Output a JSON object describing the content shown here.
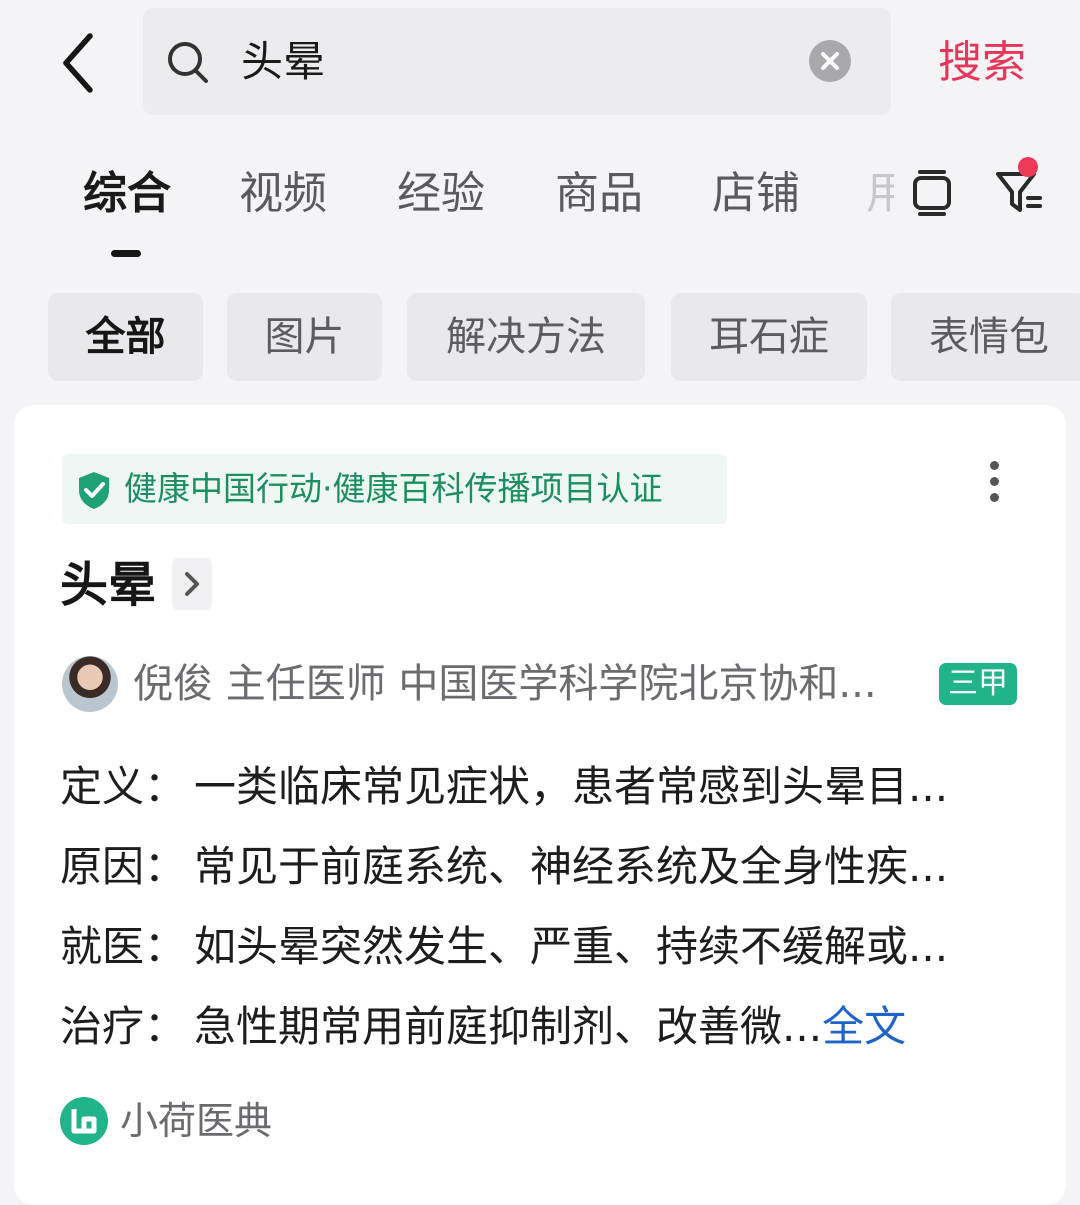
{
  "search": {
    "query": "头晕",
    "button_label": "搜索"
  },
  "tabs": [
    {
      "label": "综合",
      "active": true
    },
    {
      "label": "视频"
    },
    {
      "label": "经验"
    },
    {
      "label": "商品"
    },
    {
      "label": "店铺"
    }
  ],
  "tab_partial": "用",
  "chips": [
    {
      "label": "全部",
      "active": true
    },
    {
      "label": "图片"
    },
    {
      "label": "解决方法"
    },
    {
      "label": "耳石症"
    },
    {
      "label": "表情包"
    }
  ],
  "card": {
    "certification": "健康中国行动·健康百科传播项目认证",
    "title": "头晕",
    "doctor": "倪俊 主任医师 中国医学科学院北京协和...",
    "hospital_badge": "三甲",
    "rows": [
      {
        "label": "定义：",
        "text": "一类临床常见症状，患者常感到头晕目..."
      },
      {
        "label": "原因：",
        "text": "常见于前庭系统、神经系统及全身性疾..."
      },
      {
        "label": "就医：",
        "text": "如头晕突然发生、严重、持续不缓解或..."
      },
      {
        "label": "治疗：",
        "text": "急性期常用前庭抑制剂、改善微..."
      }
    ],
    "full_text_link": "全文",
    "source": "小荷医典"
  },
  "colors": {
    "accent": "#e8355a",
    "verified_green": "#1c8f62",
    "badge_green": "#21b38a",
    "link_blue": "#1f64c8"
  },
  "icons": [
    "back-arrow-icon",
    "search-icon",
    "clear-icon",
    "panel-icon",
    "filter-icon",
    "shield-check-icon",
    "more-icon",
    "chevron-right-icon",
    "source-logo-icon"
  ]
}
